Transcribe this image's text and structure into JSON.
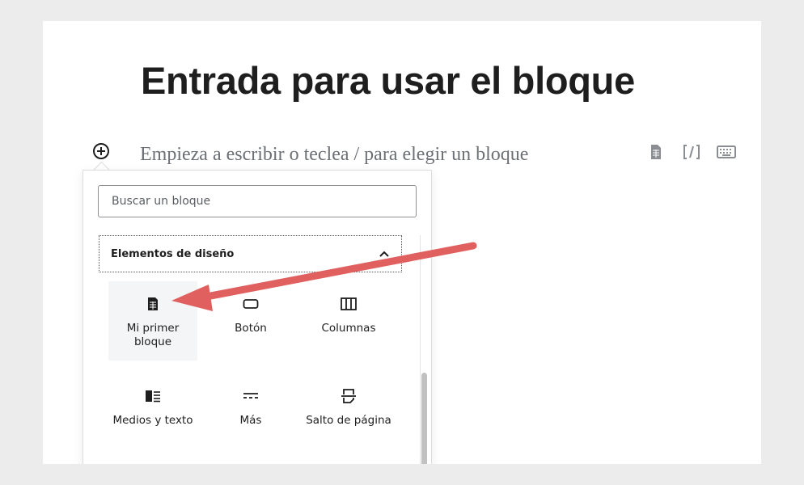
{
  "post": {
    "title": "Entrada para usar el bloque",
    "placeholder": "Empieza a escribir o teclea / para elegir un bloque"
  },
  "toolbar": {
    "icons": [
      "document-icon",
      "shortcode-icon",
      "keyboard-icon"
    ]
  },
  "inserter": {
    "search_placeholder": "Buscar un bloque",
    "panel_title": "Elementos de diseño",
    "panel_expanded": true,
    "blocks": [
      {
        "label": "Mi primer bloque",
        "icon": "document-icon",
        "highlighted": true
      },
      {
        "label": "Botón",
        "icon": "button-icon"
      },
      {
        "label": "Columnas",
        "icon": "columns-icon"
      },
      {
        "label": "Medios y texto",
        "icon": "media-text-icon"
      },
      {
        "label": "Más",
        "icon": "more-icon"
      },
      {
        "label": "Salto de página",
        "icon": "page-break-icon"
      }
    ]
  },
  "colors": {
    "annotation_arrow": "#e06060",
    "text_primary": "#1e1e1e",
    "background": "#ececec"
  }
}
